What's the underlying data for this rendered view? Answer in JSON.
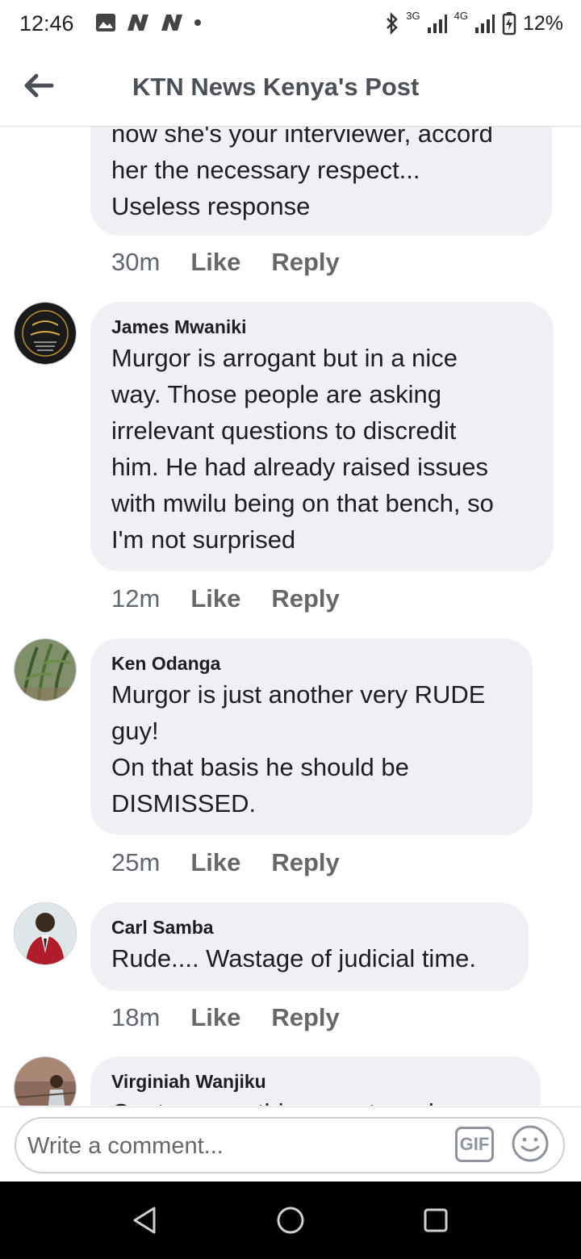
{
  "status_bar": {
    "time": "12:46",
    "battery": "12%",
    "network_1": "3G",
    "network_2": "4G"
  },
  "header": {
    "title": "KTN News Kenya's Post"
  },
  "comments": [
    {
      "author": "",
      "text": "now she's your interviewer, accord\nher the necessary respect...\nUseless response",
      "time": "30m",
      "like": "Like",
      "reply": "Reply"
    },
    {
      "author": "James Mwaniki",
      "text": "Murgor is arrogant but in a nice\nway. Those people are asking\nirrelevant questions to discredit\nhim. He had already raised issues\nwith mwilu being on that bench, so\nI'm not surprised",
      "time": "12m",
      "like": "Like",
      "reply": "Reply"
    },
    {
      "author": "Ken Odanga",
      "text": "Murgor is just another very RUDE\nguy!\nOn that basis he should be\nDISMISSED.",
      "time": "25m",
      "like": "Like",
      "reply": "Reply"
    },
    {
      "author": "Carl Samba",
      "text": "Rude.... Wastage of judicial time.",
      "time": "18m",
      "like": "Like",
      "reply": "Reply"
    },
    {
      "author": "Virginiah Wanjiku",
      "text": "Cant say anything apart ... wh",
      "time": "",
      "like": "",
      "reply": ""
    }
  ],
  "composer": {
    "placeholder": "Write a comment...",
    "gif_label": "GIF"
  }
}
